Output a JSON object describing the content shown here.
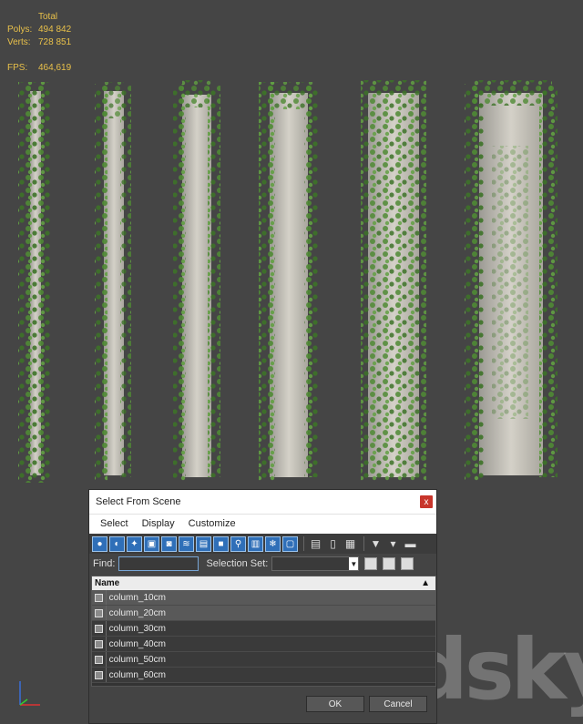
{
  "stats": {
    "header": "Total",
    "polys_label": "Polys:",
    "polys_value": "494 842",
    "verts_label": "Verts:",
    "verts_value": "728 851",
    "fps_label": "FPS:",
    "fps_value": "464,619"
  },
  "watermark": "3dsky",
  "dialog": {
    "title": "Select From Scene",
    "close": "x",
    "menu": [
      "Select",
      "Display",
      "Customize"
    ],
    "find_label": "Find:",
    "find_value": "",
    "selection_set_label": "Selection Set:",
    "selection_set_value": "",
    "list_header": "Name",
    "rows": [
      "column_10cm",
      "column_20cm",
      "column_30cm",
      "column_40cm",
      "column_50cm",
      "column_60cm"
    ],
    "ok": "OK",
    "cancel": "Cancel"
  },
  "colors": {
    "viewport_bg": "#454545",
    "stats_text": "#e8c04a",
    "foliage": "#4f8a34",
    "column_stone": "#c9c6bd",
    "toolbar_button": "#2f6fb8",
    "close_button": "#c8352b"
  }
}
